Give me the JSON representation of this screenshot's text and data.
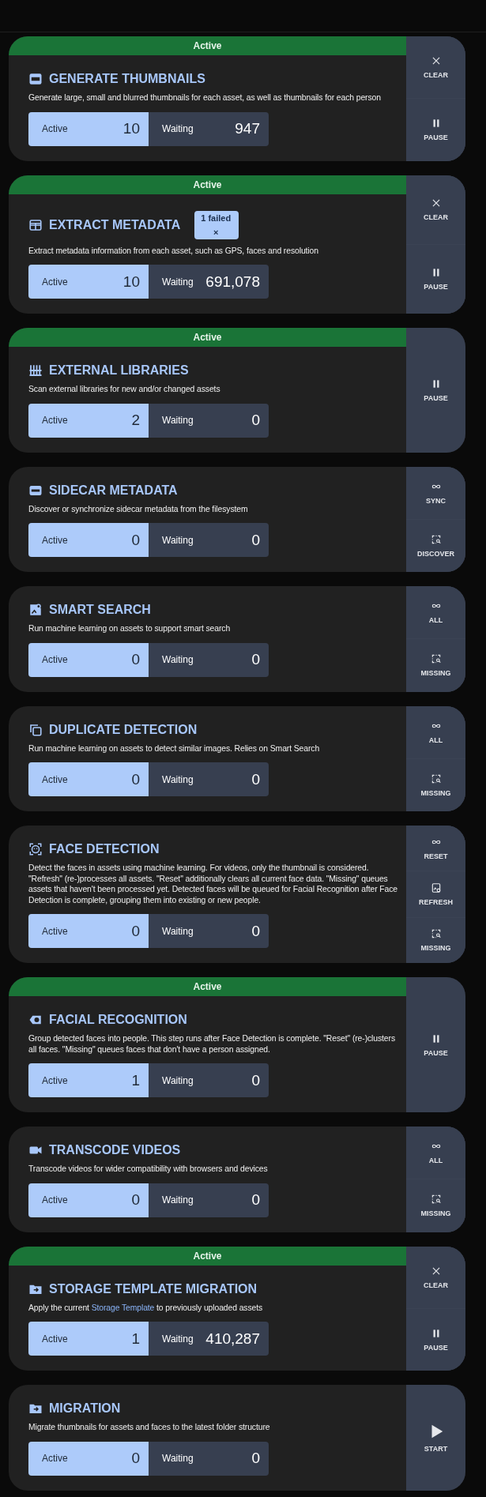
{
  "jobs": [
    {
      "kind": "jpg",
      "banner": "Active",
      "title": "GENERATE THUMBNAILS",
      "description": [
        {
          "kind": "text",
          "text": "Generate large, small and blurred thumbnails for each asset, as well as thumbnails for each person"
        }
      ],
      "stats": [
        {
          "label": "Active",
          "value": "10"
        },
        {
          "label": "Waiting",
          "value": "947"
        }
      ],
      "actions": [
        {
          "kind": "clear",
          "label": "CLEAR"
        },
        {
          "kind": "pause",
          "label": "PAUSE"
        }
      ]
    },
    {
      "kind": "table",
      "banner": "Active",
      "title": "EXTRACT METADATA",
      "badge": {
        "label": "1 failed",
        "close": "×"
      },
      "description": [
        {
          "kind": "text",
          "text": "Extract metadata information from each asset, such as GPS, faces and resolution"
        }
      ],
      "stats": [
        {
          "label": "Active",
          "value": "10"
        },
        {
          "label": "Waiting",
          "value": "691,078"
        }
      ],
      "actions": [
        {
          "kind": "clear",
          "label": "CLEAR"
        },
        {
          "kind": "pause",
          "label": "PAUSE"
        }
      ]
    },
    {
      "kind": "library",
      "banner": "Active",
      "title": "EXTERNAL LIBRARIES",
      "description": [
        {
          "kind": "text",
          "text": "Scan external libraries for new and/or changed assets"
        }
      ],
      "stats": [
        {
          "label": "Active",
          "value": "2"
        },
        {
          "label": "Waiting",
          "value": "0"
        }
      ],
      "actions": [
        {
          "kind": "pause",
          "label": "PAUSE"
        }
      ]
    },
    {
      "kind": "xml",
      "title": "SIDECAR METADATA",
      "description": [
        {
          "kind": "text",
          "text": "Discover or synchronize sidecar metadata from the filesystem"
        }
      ],
      "stats": [
        {
          "label": "Active",
          "value": "0"
        },
        {
          "label": "Waiting",
          "value": "0"
        }
      ],
      "actions": [
        {
          "kind": "all",
          "label": "SYNC"
        },
        {
          "kind": "missing",
          "label": "DISCOVER"
        }
      ]
    },
    {
      "kind": "image-search",
      "title": "SMART SEARCH",
      "description": [
        {
          "kind": "text",
          "text": "Run machine learning on assets to support smart search"
        }
      ],
      "stats": [
        {
          "label": "Active",
          "value": "0"
        },
        {
          "label": "Waiting",
          "value": "0"
        }
      ],
      "actions": [
        {
          "kind": "all",
          "label": "ALL"
        },
        {
          "kind": "missing",
          "label": "MISSING"
        }
      ]
    },
    {
      "kind": "copy",
      "title": "DUPLICATE DETECTION",
      "description": [
        {
          "kind": "text",
          "text": "Run machine learning on assets to detect similar images. Relies on Smart Search"
        }
      ],
      "stats": [
        {
          "label": "Active",
          "value": "0"
        },
        {
          "label": "Waiting",
          "value": "0"
        }
      ],
      "actions": [
        {
          "kind": "all",
          "label": "ALL"
        },
        {
          "kind": "missing",
          "label": "MISSING"
        }
      ]
    },
    {
      "kind": "face",
      "title": "FACE DETECTION",
      "description": [
        {
          "kind": "text",
          "text": "Detect the faces in assets using machine learning. For videos, only the thumbnail is considered. \"Refresh\" (re-)processes all assets. \"Reset\" additionally clears all current face data. \"Missing\" queues assets that haven't been processed yet. Detected faces will be queued for Facial Recognition after Face Detection is complete, grouping them into existing or new people."
        }
      ],
      "stats": [
        {
          "label": "Active",
          "value": "0"
        },
        {
          "label": "Waiting",
          "value": "0"
        }
      ],
      "actions": [
        {
          "kind": "all",
          "label": "RESET"
        },
        {
          "kind": "refresh",
          "label": "REFRESH"
        },
        {
          "kind": "missing",
          "label": "MISSING"
        }
      ]
    },
    {
      "kind": "tag",
      "banner": "Active",
      "title": "FACIAL RECOGNITION",
      "description": [
        {
          "kind": "text",
          "text": "Group detected faces into people. This step runs after Face Detection is complete. \"Reset\" (re-)clusters all faces. \"Missing\" queues faces that don't have a person assigned."
        }
      ],
      "stats": [
        {
          "label": "Active",
          "value": "1"
        },
        {
          "label": "Waiting",
          "value": "0"
        }
      ],
      "actions": [
        {
          "kind": "pause",
          "label": "PAUSE"
        }
      ]
    },
    {
      "kind": "video",
      "title": "TRANSCODE VIDEOS",
      "description": [
        {
          "kind": "text",
          "text": "Transcode videos for wider compatibility with browsers and devices"
        }
      ],
      "stats": [
        {
          "label": "Active",
          "value": "0"
        },
        {
          "label": "Waiting",
          "value": "0"
        }
      ],
      "actions": [
        {
          "kind": "all",
          "label": "ALL"
        },
        {
          "kind": "missing",
          "label": "MISSING"
        }
      ]
    },
    {
      "kind": "folder",
      "banner": "Active",
      "title": "STORAGE TEMPLATE MIGRATION",
      "description": [
        {
          "kind": "text",
          "text": "Apply the current "
        },
        {
          "kind": "link",
          "text": "Storage Template"
        },
        {
          "kind": "text",
          "text": " to previously uploaded assets"
        }
      ],
      "stats": [
        {
          "label": "Active",
          "value": "1"
        },
        {
          "label": "Waiting",
          "value": "410,287"
        }
      ],
      "actions": [
        {
          "kind": "clear",
          "label": "CLEAR"
        },
        {
          "kind": "pause",
          "label": "PAUSE"
        }
      ]
    },
    {
      "kind": "folder",
      "title": "MIGRATION",
      "description": [
        {
          "kind": "text",
          "text": "Migrate thumbnails for assets and faces to the latest folder structure"
        }
      ],
      "stats": [
        {
          "label": "Active",
          "value": "0"
        },
        {
          "label": "Waiting",
          "value": "0"
        }
      ],
      "actions": [
        {
          "kind": "start",
          "label": "START"
        }
      ]
    }
  ]
}
